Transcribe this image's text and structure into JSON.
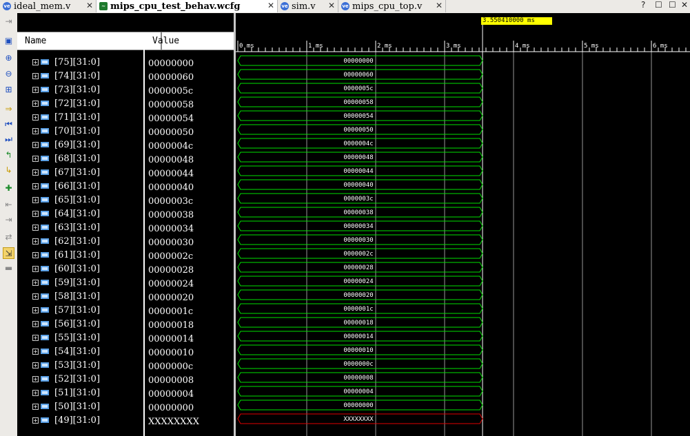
{
  "tabs": [
    {
      "label": "ideal_mem.v",
      "icon": "verilog-file-icon",
      "active": false
    },
    {
      "label": "mips_cpu_test_behav.wcfg",
      "icon": "waveform-file-icon",
      "active": true
    },
    {
      "label": "sim.v",
      "icon": "verilog-file-icon",
      "active": false
    },
    {
      "label": "mips_cpu_top.v",
      "icon": "verilog-file-icon",
      "active": false
    }
  ],
  "window_controls": {
    "help": "?",
    "restore": "☐",
    "maximize": "☐",
    "close": "✕"
  },
  "toolbar": [
    "zoom-in-icon",
    "zoom-out-icon",
    "zoom-fit-icon",
    "go-to-cursor-icon",
    "go-to-time-0-icon",
    "go-to-last-time-icon",
    "previous-transition-icon",
    "next-transition-icon",
    "add-marker-icon",
    "previous-marker-icon",
    "next-marker-icon",
    "swap-cursors-icon",
    "snap-to-transition-icon",
    "float-ruler-icon",
    "save-icon",
    "expand-icon"
  ],
  "columns": {
    "name": "Name",
    "value": "Value"
  },
  "cursor": {
    "time_label": "3.550410000 ms",
    "time_ms": 3.55041
  },
  "timeline": {
    "labels": [
      "0 ms",
      "1 ms",
      "2 ms",
      "3 ms",
      "4 ms",
      "5 ms",
      "6 ms"
    ],
    "end_ms": 6.55
  },
  "signals": [
    {
      "name": "[75][31:0]",
      "value": "00000000",
      "wave": "00000000"
    },
    {
      "name": "[74][31:0]",
      "value": "00000060",
      "wave": "00000060"
    },
    {
      "name": "[73][31:0]",
      "value": "0000005c",
      "wave": "0000005c"
    },
    {
      "name": "[72][31:0]",
      "value": "00000058",
      "wave": "00000058"
    },
    {
      "name": "[71][31:0]",
      "value": "00000054",
      "wave": "00000054"
    },
    {
      "name": "[70][31:0]",
      "value": "00000050",
      "wave": "00000050"
    },
    {
      "name": "[69][31:0]",
      "value": "0000004c",
      "wave": "0000004c"
    },
    {
      "name": "[68][31:0]",
      "value": "00000048",
      "wave": "00000048"
    },
    {
      "name": "[67][31:0]",
      "value": "00000044",
      "wave": "00000044"
    },
    {
      "name": "[66][31:0]",
      "value": "00000040",
      "wave": "00000040"
    },
    {
      "name": "[65][31:0]",
      "value": "0000003c",
      "wave": "0000003c"
    },
    {
      "name": "[64][31:0]",
      "value": "00000038",
      "wave": "00000038"
    },
    {
      "name": "[63][31:0]",
      "value": "00000034",
      "wave": "00000034"
    },
    {
      "name": "[62][31:0]",
      "value": "00000030",
      "wave": "00000030"
    },
    {
      "name": "[61][31:0]",
      "value": "0000002c",
      "wave": "0000002c"
    },
    {
      "name": "[60][31:0]",
      "value": "00000028",
      "wave": "00000028"
    },
    {
      "name": "[59][31:0]",
      "value": "00000024",
      "wave": "00000024"
    },
    {
      "name": "[58][31:0]",
      "value": "00000020",
      "wave": "00000020"
    },
    {
      "name": "[57][31:0]",
      "value": "0000001c",
      "wave": "0000001c"
    },
    {
      "name": "[56][31:0]",
      "value": "00000018",
      "wave": "00000018"
    },
    {
      "name": "[55][31:0]",
      "value": "00000014",
      "wave": "00000014"
    },
    {
      "name": "[54][31:0]",
      "value": "00000010",
      "wave": "00000010"
    },
    {
      "name": "[53][31:0]",
      "value": "0000000c",
      "wave": "0000000c"
    },
    {
      "name": "[52][31:0]",
      "value": "00000008",
      "wave": "00000008"
    },
    {
      "name": "[51][31:0]",
      "value": "00000004",
      "wave": "00000004"
    },
    {
      "name": "[50][31:0]",
      "value": "00000000",
      "wave": "00000000"
    },
    {
      "name": "[49][31:0]",
      "value": "XXXXXXXX",
      "wave": "XXXXXXXX",
      "unknown": true
    }
  ],
  "colors": {
    "wave_valid": "#00e000",
    "wave_unknown": "#e00000",
    "cursor": "#ffff00",
    "bus_icon": "#5aa0e6",
    "tab_active_bg": "#ffffff"
  }
}
